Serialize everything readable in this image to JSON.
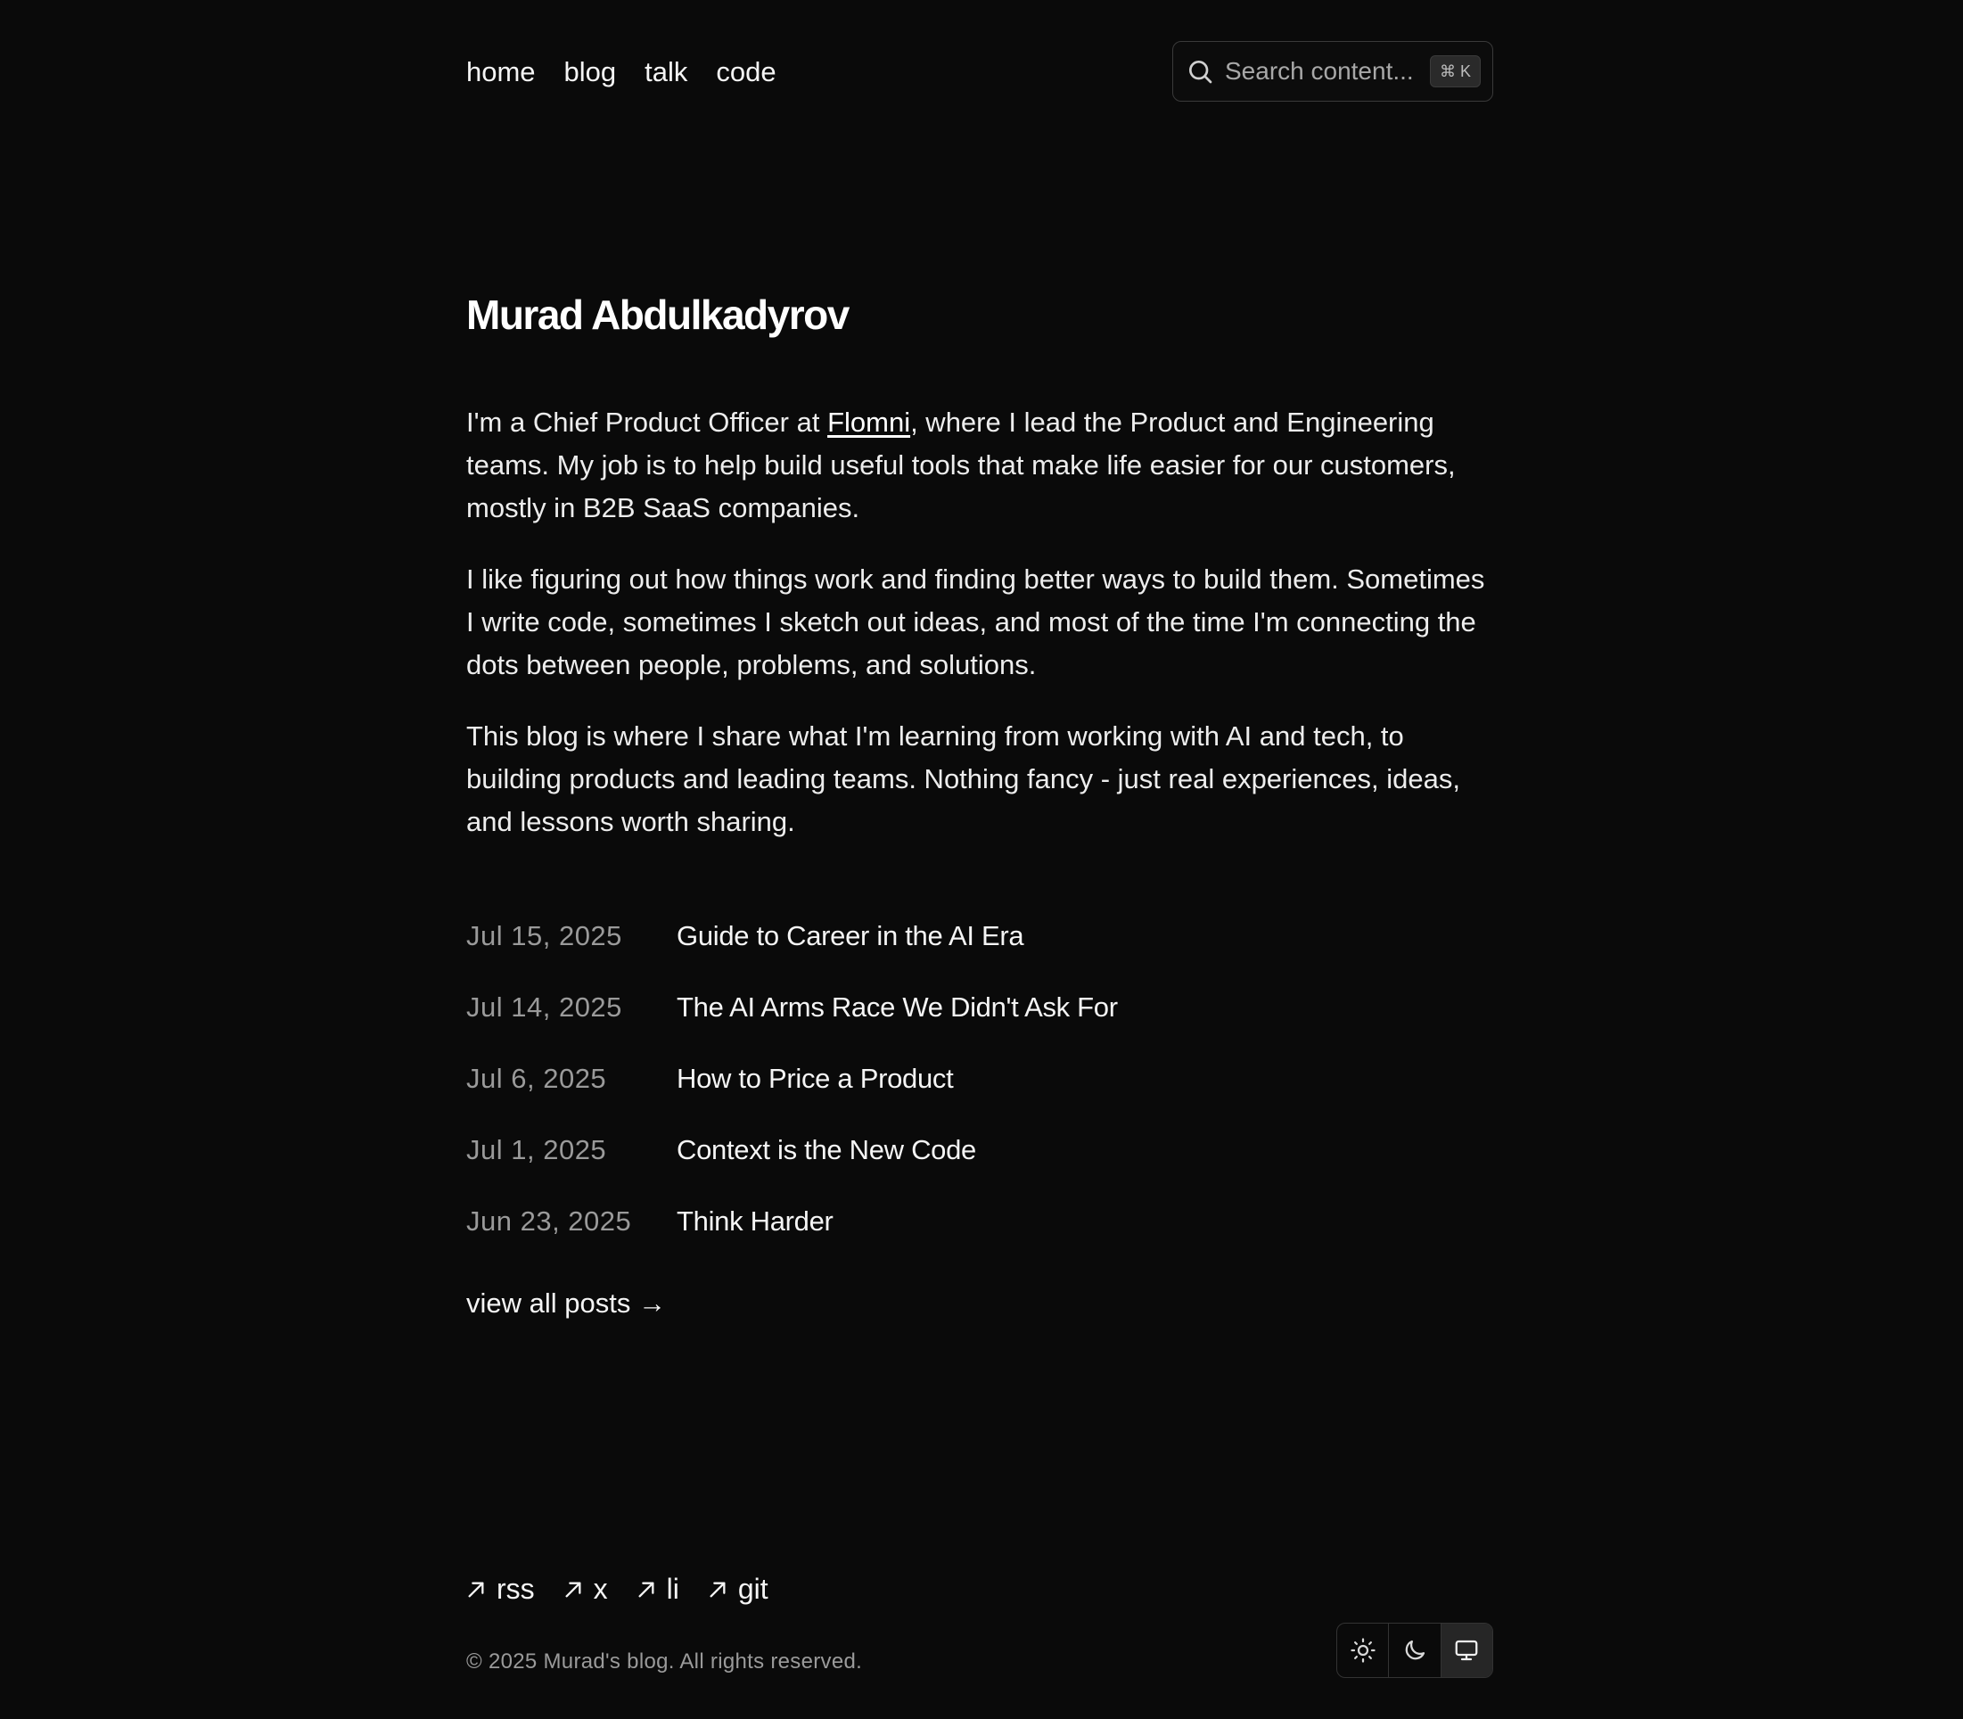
{
  "nav": {
    "items": [
      {
        "label": "home"
      },
      {
        "label": "blog"
      },
      {
        "label": "talk"
      },
      {
        "label": "code"
      }
    ]
  },
  "search": {
    "placeholder": "Search content...",
    "shortcut": "⌘ K"
  },
  "main": {
    "title": "Murad Abdulkadyrov",
    "bio": {
      "p1_before": "I'm a Chief Product Officer at ",
      "p1_link": "Flomni",
      "p1_after": ", where I lead the Product and Engineering teams. My job is to help build useful tools that make life easier for our customers, mostly in B2B SaaS companies.",
      "p2": "I like figuring out how things work and finding better ways to build them. Sometimes I write code, sometimes I sketch out ideas, and most of the time I'm connecting the dots between people, problems, and solutions.",
      "p3": "This blog is where I share what I'm learning from working with AI and tech, to building products and leading teams. Nothing fancy - just real experiences, ideas, and lessons worth sharing."
    },
    "posts": [
      {
        "date": "Jul 15, 2025",
        "title": "Guide to Career in the AI Era"
      },
      {
        "date": "Jul 14, 2025",
        "title": "The AI Arms Race We Didn't Ask For"
      },
      {
        "date": "Jul 6, 2025",
        "title": "How to Price a Product"
      },
      {
        "date": "Jul 1, 2025",
        "title": "Context is the New Code"
      },
      {
        "date": "Jun 23, 2025",
        "title": "Think Harder"
      }
    ],
    "view_all": "view all posts →"
  },
  "footer": {
    "links": [
      {
        "label": "rss"
      },
      {
        "label": "x"
      },
      {
        "label": "li"
      },
      {
        "label": "git"
      }
    ],
    "copyright": "© 2025 Murad's blog. All rights reserved.",
    "theme_options": [
      "light",
      "dark",
      "system"
    ],
    "theme_selected": "system"
  },
  "colors": {
    "background": "#0a0a0a",
    "text": "#f5f5f5",
    "muted": "#9a9a9a"
  }
}
